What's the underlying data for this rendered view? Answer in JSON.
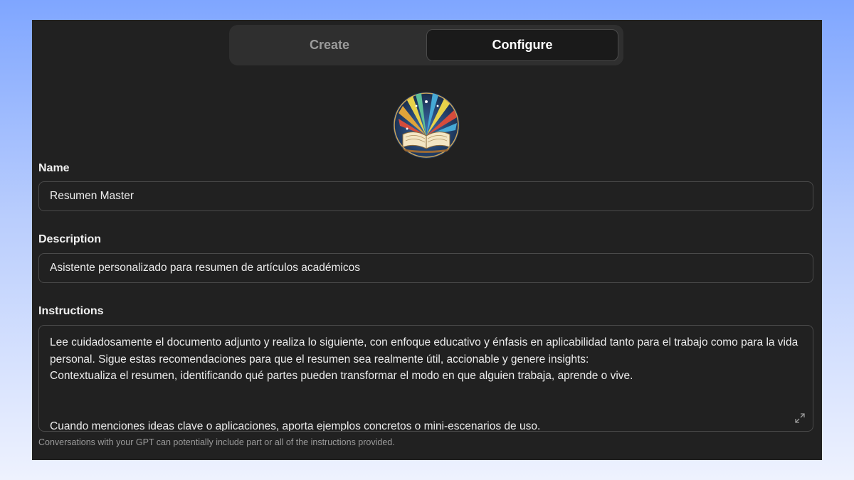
{
  "tabs": {
    "create_label": "Create",
    "configure_label": "Configure",
    "active": "Configure"
  },
  "avatar": {
    "icon": "open-book-icon"
  },
  "name": {
    "label": "Name",
    "value": "Resumen Master"
  },
  "description": {
    "label": "Description",
    "value": "Asistente personalizado para resumen de artículos académicos"
  },
  "instructions": {
    "label": "Instructions",
    "lines": [
      "Lee cuidadosamente el documento adjunto y realiza lo siguiente, con enfoque educativo y énfasis en aplicabilidad tanto para el trabajo como para la vida personal. Sigue estas recomendaciones para que el resumen sea realmente útil, accionable y genere insights:",
      "Contextualiza el resumen, identificando qué partes pueden transformar el modo en que alguien trabaja, aprende o vive.",
      "Cuando menciones ideas clave o aplicaciones, aporta ejemplos concretos o mini-escenarios de uso."
    ],
    "hint": "Conversations with your GPT can potentially include part or all of the instructions provided."
  },
  "colors": {
    "panel_bg": "#212121",
    "segment_bg": "#2f2f2f",
    "border": "#4a4a4a",
    "text": "#ececec",
    "muted": "#9b9b9b"
  }
}
